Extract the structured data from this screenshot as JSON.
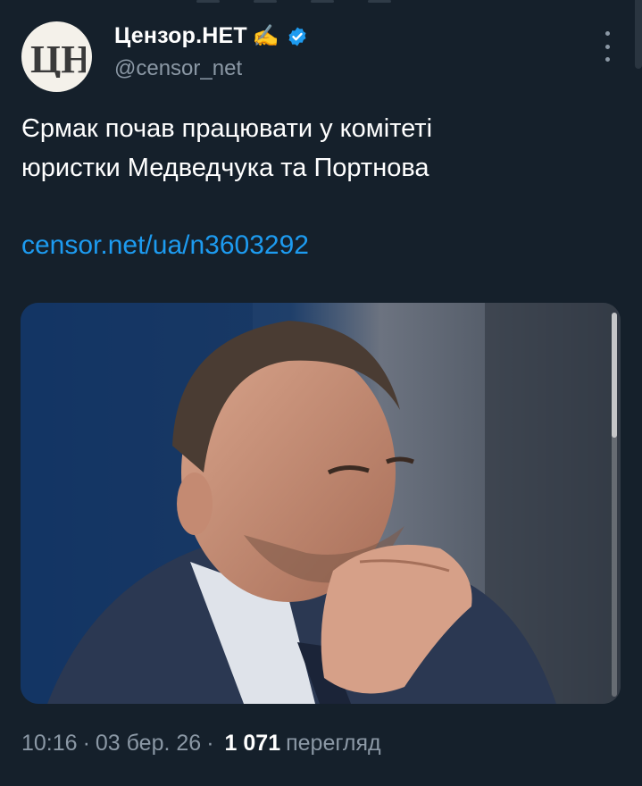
{
  "tweet": {
    "author": {
      "name": "Цензор.НЕТ",
      "emoji": "✍️",
      "handle": "@censor_net",
      "verified": true,
      "avatar_text": "ЦН"
    },
    "text_line1": "Єрмак почав працювати у комітеті",
    "text_line2": "юристки Медведчука та Портнова",
    "link": "censor.net/ua/n3603292",
    "time": "10:16",
    "date": "03 бер. 26",
    "views_count": "1 071",
    "views_label": "перегляд",
    "separator": "·"
  },
  "colors": {
    "background": "#15202b",
    "link": "#1d9bf0",
    "secondary_text": "#8b98a5",
    "verified_badge": "#1d9bf0"
  },
  "icons": {
    "verified": "verified-badge-icon",
    "more": "more-vertical-icon"
  }
}
